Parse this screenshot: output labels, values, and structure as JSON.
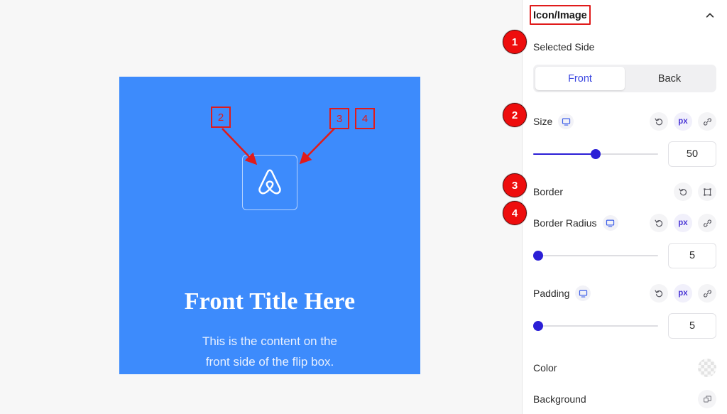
{
  "canvas": {
    "flipbox": {
      "icon_name": "airbnb-logo-icon",
      "title": "Front Title Here",
      "content_line1": "This is the content on the",
      "content_line2": "front side of the flip box.",
      "background_color": "#3d8bfc"
    }
  },
  "annotations": {
    "accent_color": "#e01b1b",
    "badges": [
      {
        "number": "1",
        "target": "Selected Side"
      },
      {
        "number": "2",
        "target": "Size"
      },
      {
        "number": "3",
        "target": "Border"
      },
      {
        "number": "4",
        "target": "Border Radius"
      }
    ],
    "canvas_markers": [
      {
        "number": "2"
      },
      {
        "number": "3"
      },
      {
        "number": "4"
      }
    ]
  },
  "panel": {
    "header": {
      "title": "Icon/Image",
      "collapse_icon": "chevron-up-icon"
    },
    "selected_side": {
      "label": "Selected Side",
      "options": [
        "Front",
        "Back"
      ],
      "selected": "Front"
    },
    "size": {
      "label": "Size",
      "device_icon": "desktop-icon",
      "tools": [
        "reset-icon",
        "px",
        "link-icon"
      ],
      "unit": "px",
      "value": "50",
      "slider_percent": 50
    },
    "border": {
      "label": "Border",
      "tools": [
        "reset-icon",
        "border-frame-icon"
      ]
    },
    "border_radius": {
      "label": "Border Radius",
      "device_icon": "desktop-icon",
      "tools": [
        "reset-icon",
        "px",
        "link-icon"
      ],
      "unit": "px",
      "value": "5",
      "slider_percent": 3
    },
    "padding": {
      "label": "Padding",
      "device_icon": "desktop-icon",
      "tools": [
        "reset-icon",
        "px",
        "link-icon"
      ],
      "unit": "px",
      "value": "5",
      "slider_percent": 3
    },
    "color": {
      "label": "Color",
      "swatch": "transparent-checkerboard"
    },
    "background": {
      "label": "Background",
      "icon": "layers-copy-icon"
    }
  }
}
